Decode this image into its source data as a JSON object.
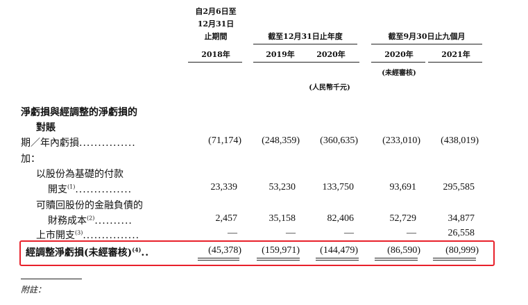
{
  "header": {
    "col1_title_lines": [
      "自2月6日至",
      "12月31日",
      "止期間"
    ],
    "group_year_title": "截至12月31日止年度",
    "group_nine_month_title": "截至9月30日止九個月",
    "years": [
      "2018年",
      "2019年",
      "2020年",
      "2020年",
      "2021年"
    ],
    "unaudited_note": "(未經審核)",
    "currency_unit": "(人民幣千元)"
  },
  "section_title_lines": [
    "淨虧損與經調整的淨虧損的",
    "對賬"
  ],
  "rows": [
    {
      "label": "期／年內虧損",
      "sup": "",
      "dots": "...............",
      "values": [
        "(71,174)",
        "(248,359)",
        "(360,635)",
        "(233,010)",
        "(438,019)"
      ]
    },
    {
      "label": "加：",
      "sup": "",
      "dots": "",
      "values": []
    },
    {
      "label": "以股份為基礎的付款",
      "sup": "",
      "dots": "",
      "values": []
    },
    {
      "label": "開支",
      "sup": "(1)",
      "dots": "...............",
      "values": [
        "23,339",
        "53,230",
        "133,750",
        "93,691",
        "295,585"
      ]
    },
    {
      "label": "可贖回股份的金融負債的",
      "sup": "",
      "dots": "",
      "values": []
    },
    {
      "label": "財務成本",
      "sup": "(2)",
      "dots": "..........",
      "values": [
        "2,457",
        "35,158",
        "82,406",
        "52,729",
        "34,877"
      ]
    },
    {
      "label": "上市開支",
      "sup": "(3)",
      "dots": "...............",
      "values": [
        "—",
        "—",
        "—",
        "—",
        "26,558"
      ]
    },
    {
      "label": "經調整淨虧損(未經審核)",
      "sup": "(4)",
      "dots": "..",
      "values": [
        "(45,378)",
        "(159,971)",
        "(144,479)",
        "(86,590)",
        "(80,999)"
      ]
    }
  ],
  "footnote_label": "附註：",
  "colors": {
    "highlight": "#e8202a",
    "text": "#111111"
  }
}
